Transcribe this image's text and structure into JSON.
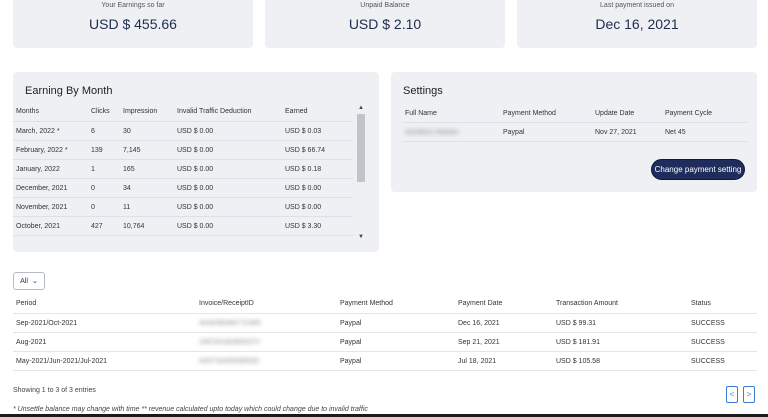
{
  "stats": {
    "earnings": {
      "label": "Your Earnings so far",
      "value": "USD $ 455.66"
    },
    "unpaid": {
      "label": "Unpaid Balance",
      "value": "USD $ 2.10"
    },
    "last_payment": {
      "label": "Last payment issued on",
      "value": "Dec 16, 2021"
    }
  },
  "earning_by_month": {
    "title": "Earning By Month",
    "headers": {
      "month": "Months",
      "clicks": "Clicks",
      "impression": "Impression",
      "itd": "Invalid Traffic Deduction",
      "earned": "Earned"
    },
    "rows": [
      {
        "month": "March, 2022 *",
        "clicks": "6",
        "impression": "30",
        "itd": "USD $ 0.00",
        "earned": "USD $ 0.03"
      },
      {
        "month": "February, 2022 *",
        "clicks": "139",
        "impression": "7,145",
        "itd": "USD $ 0.00",
        "earned": "USD $ 66.74"
      },
      {
        "month": "January, 2022",
        "clicks": "1",
        "impression": "165",
        "itd": "USD $ 0.00",
        "earned": "USD $ 0.18"
      },
      {
        "month": "December, 2021",
        "clicks": "0",
        "impression": "34",
        "itd": "USD $ 0.00",
        "earned": "USD $ 0.00"
      },
      {
        "month": "November, 2021",
        "clicks": "0",
        "impression": "11",
        "itd": "USD $ 0.00",
        "earned": "USD $ 0.00"
      },
      {
        "month": "October, 2021",
        "clicks": "427",
        "impression": "10,764",
        "itd": "USD $ 0.00",
        "earned": "USD $ 3.30"
      }
    ],
    "scroll_up": "▲",
    "scroll_down": "▼"
  },
  "settings": {
    "title": "Settings",
    "headers": {
      "name": "Full Name",
      "method": "Payment Method",
      "date": "Update Date",
      "cycle": "Payment Cycle"
    },
    "row": {
      "name": "Ayotilbun Abalam",
      "method": "Paypal",
      "date": "Nov 27, 2021",
      "cycle": "Net 45"
    },
    "button": "Change payment setting"
  },
  "entries_select": {
    "value": "All",
    "chevron": "⌄"
  },
  "payments": {
    "headers": {
      "period": "Period",
      "invoice": "Invoice/ReceiptID",
      "method": "Payment Method",
      "date": "Payment Date",
      "amount": "Transaction Amount",
      "status": "Status"
    },
    "rows": [
      {
        "period": "Sep-2021/Oct-2021",
        "invoice": "4H4D9838877C665",
        "method": "Paypal",
        "date": "Dec 16, 2021",
        "amount": "USD $ 99.31",
        "status": "SUCCESS"
      },
      {
        "period": "Aug-2021",
        "invoice": "1MC5H1B2B0037V",
        "method": "Paypal",
        "date": "Sep 21, 2021",
        "amount": "USD $ 181.91",
        "status": "SUCCESS"
      },
      {
        "period": "May-2021/Jun-2021/Jul-2021",
        "invoice": "4H0734A5D0B5G0",
        "method": "Paypal",
        "date": "Jul 18, 2021",
        "amount": "USD $ 105.58",
        "status": "SUCCESS"
      }
    ]
  },
  "pagination": {
    "showing": "Showing 1 to 3 of 3 entries",
    "prev": "<",
    "next": ">"
  },
  "footnote": "* Unsettle balance may change with time ** revenue calculated upto today which could change due to invalid traffic"
}
